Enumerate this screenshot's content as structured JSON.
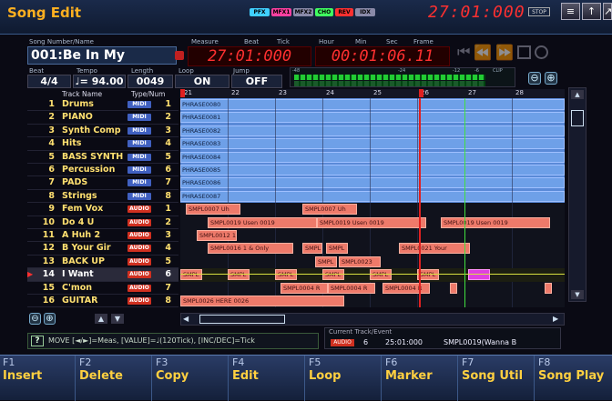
{
  "title": "Song Edit",
  "indicators": [
    {
      "label": "PFX",
      "color": "#40d0ff"
    },
    {
      "label": "MFX1",
      "color": "#ff40a0"
    },
    {
      "label": "MFX2",
      "color": "#8a8aa8"
    },
    {
      "label": "CHO",
      "color": "#40ff60"
    },
    {
      "label": "REV",
      "color": "#ff3030"
    },
    {
      "label": "IDX",
      "color": "#8a8aa8"
    }
  ],
  "clock": "27:01:000",
  "stop_label": "STOP",
  "song": {
    "number_label": "Song Number/Name",
    "name": "001:Be In My",
    "beat_label": "Beat",
    "beat": "4/4",
    "tempo_label": "Tempo",
    "tempo": "♩= 94.00",
    "length_label": "Length",
    "length": "0049",
    "loop_label": "Loop",
    "loop": "ON",
    "jump_label": "Jump",
    "jump": "OFF"
  },
  "counters": {
    "measure_label": "Measure",
    "beat_label": "Beat",
    "tick_label": "Tick",
    "measure_value": "27:01:000",
    "hour_label": "Hour",
    "min_label": "Min",
    "sec_label": "Sec",
    "frame_label": "Frame",
    "time_value": "00:01:06.11"
  },
  "meter": {
    "scale_left": "-48",
    "scale_24": "-24",
    "scale_12": "-12",
    "scale_6": "-6",
    "clip": "CLIP"
  },
  "columns": {
    "name": "Track Name",
    "type": "Type/Num"
  },
  "tracks": [
    {
      "num": "1",
      "name": "Drums",
      "type": "MIDI",
      "tnum": "1"
    },
    {
      "num": "2",
      "name": "PIANO",
      "type": "MIDI",
      "tnum": "2"
    },
    {
      "num": "3",
      "name": "Synth Comp",
      "type": "MIDI",
      "tnum": "3"
    },
    {
      "num": "4",
      "name": "Hits",
      "type": "MIDI",
      "tnum": "4"
    },
    {
      "num": "5",
      "name": "BASS SYNTH",
      "type": "MIDI",
      "tnum": "5"
    },
    {
      "num": "6",
      "name": "Percussion",
      "type": "MIDI",
      "tnum": "6"
    },
    {
      "num": "7",
      "name": "PADS",
      "type": "MIDI",
      "tnum": "7"
    },
    {
      "num": "8",
      "name": "Strings",
      "type": "MIDI",
      "tnum": "8"
    },
    {
      "num": "9",
      "name": "Fem Vox",
      "type": "AUDIO",
      "tnum": "1"
    },
    {
      "num": "10",
      "name": "Do 4 U",
      "type": "AUDIO",
      "tnum": "2"
    },
    {
      "num": "11",
      "name": "A Huh 2",
      "type": "AUDIO",
      "tnum": "3"
    },
    {
      "num": "12",
      "name": "B Your Gir",
      "type": "AUDIO",
      "tnum": "4"
    },
    {
      "num": "13",
      "name": "BACK UP",
      "type": "AUDIO",
      "tnum": "5"
    },
    {
      "num": "14",
      "name": "I Want",
      "type": "AUDIO",
      "tnum": "6"
    },
    {
      "num": "15",
      "name": "C'mon",
      "type": "AUDIO",
      "tnum": "7"
    },
    {
      "num": "16",
      "name": "GUITAR",
      "type": "AUDIO",
      "tnum": "8"
    }
  ],
  "ruler": [
    "21",
    "22",
    "23",
    "24",
    "25",
    "26",
    "27",
    "28"
  ],
  "phrases": [
    "PHRASE0080",
    "PHRASE0081",
    "PHRASE0082",
    "PHRASE0083",
    "PHRASE0084",
    "PHRASE0085",
    "PHRASE0086",
    "PHRASE0087"
  ],
  "samples": {
    "t9a": "SMPL0007 Uh",
    "t9b": "SMPL0007 Uh",
    "t10a": "SMPL0019 Usen 0019",
    "t10b": "SMPL0019 Usen 0019",
    "t10c": "SMPL0019 Usen 0019",
    "t11a": "SMPL0012 1 & Only",
    "t12a": "SMPL0016 1 & Only",
    "t12b": "SMPL",
    "t12c": "SMPL",
    "t12d": "SMPL0021 Your",
    "t13a": "SMPL",
    "t13b": "SMPL0023",
    "t14a": "SMPL",
    "t14b": "SMPL",
    "t14c": "SMPL",
    "t14d": "SMPL",
    "t14e": "SMPL",
    "t14f": "SMPL",
    "t15a": "SMPL0004 R",
    "t15b": "SMPL0004 R",
    "t15c": "SMPL0004 R",
    "t16a": "SMPL0026 HERE 0026"
  },
  "status": "MOVE [◄/►]=Meas, [VALUE]=♩(120Tick), [INC/DEC]=Tick",
  "current": {
    "label": "Current Track/Event",
    "type": "AUDIO",
    "track": "6",
    "position": "25:01:000",
    "event": "SMPL0019(Wanna B"
  },
  "fkeys": [
    {
      "fn": "F1",
      "label": "Insert"
    },
    {
      "fn": "F2",
      "label": "Delete"
    },
    {
      "fn": "F3",
      "label": "Copy"
    },
    {
      "fn": "F4",
      "label": "Edit"
    },
    {
      "fn": "F5",
      "label": "Loop"
    },
    {
      "fn": "F6",
      "label": "Marker"
    },
    {
      "fn": "F7",
      "label": "Song Util"
    },
    {
      "fn": "F8",
      "label": "Song Play"
    }
  ],
  "colors": {
    "midi": "#4060c0",
    "audio": "#d03020",
    "phrase": "#6ea0e8",
    "sample": "#ee7a6a",
    "accent": "#ffd040"
  }
}
